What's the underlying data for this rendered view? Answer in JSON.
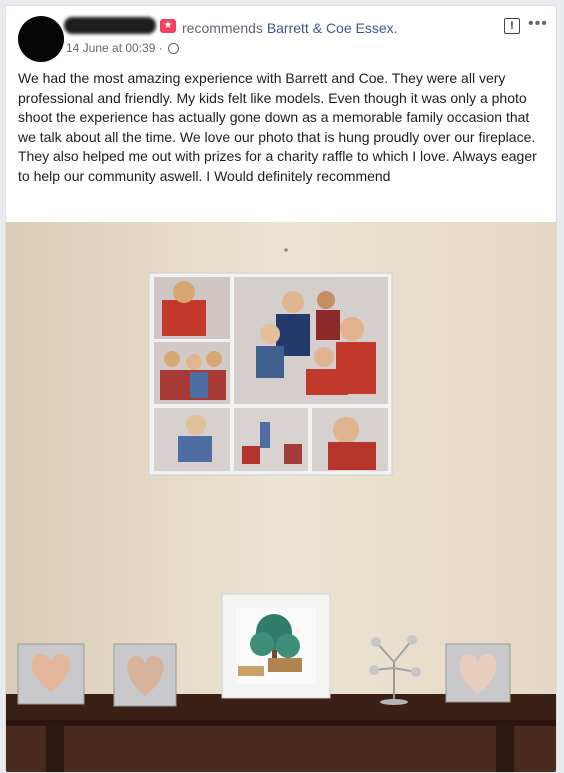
{
  "post": {
    "recommend_verb": "recommends",
    "page_name": "Barrett & Coe Essex.",
    "date": "14 June at 00:39",
    "separator": " · ",
    "body": "We had the most amazing experience with Barrett and Coe. They were all very professional and friendly. My kids felt like models. Even though it was only a photo shoot the experience has actually gone down as a memorable family occasion that we talk about all the time. We love our photo that is hung proudly over our fireplace. They also helped me out with prizes for a charity raffle to which I love. Always eager to help our community aswell. I Would definitely recommend"
  },
  "icons": {
    "recommend": "recommend-star-icon",
    "privacy": "globe-icon",
    "report": "report-icon",
    "more": "more-options-icon"
  },
  "colors": {
    "link": "#385898",
    "secondary_text": "#606770",
    "recommend_badge": "#f3425f",
    "wall": "#e8dfcb",
    "mantel": "#3a1f14"
  }
}
